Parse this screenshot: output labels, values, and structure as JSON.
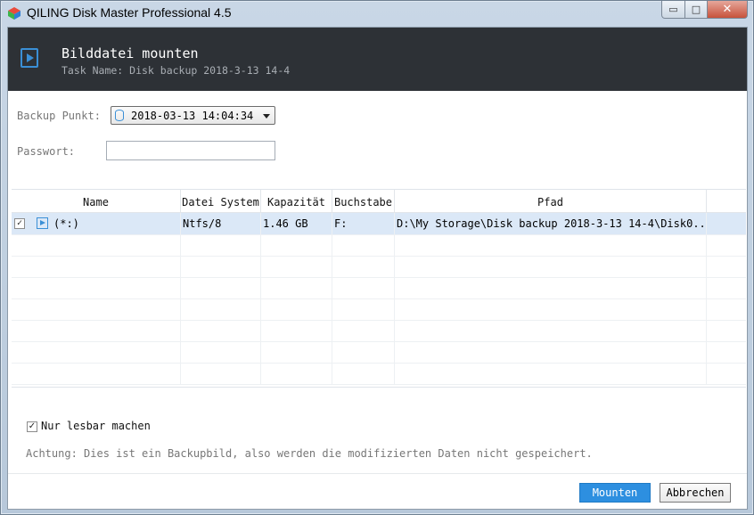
{
  "window": {
    "title": "QILING Disk Master Professional 4.5",
    "controls": {
      "minimize": "▭",
      "maximize": "□",
      "close": "✕"
    }
  },
  "header": {
    "title": "Bilddatei mounten",
    "subtitle": "Task Name: Disk backup 2018-3-13 14-4",
    "icon": "play-icon",
    "background": "#2d3136"
  },
  "form": {
    "backup_point_label": "Backup Punkt:",
    "backup_point_value": "2018-03-13 14:04:34",
    "password_label": "Passwort:",
    "password_value": ""
  },
  "table": {
    "columns": [
      "Name",
      "Datei System",
      "Kapazität",
      "Buchstabe",
      "Pfad"
    ],
    "rows": [
      {
        "checked": true,
        "name": "(*:)",
        "fs": "Ntfs/8",
        "capacity": "1.46 GB",
        "letter": "F:",
        "path": "D:\\My Storage\\Disk backup 2018-3-13 14-4\\Disk0..."
      }
    ],
    "empty_rows": 7
  },
  "options": {
    "readonly_label": "Nur lesbar machen",
    "readonly_checked": true
  },
  "warning": "Achtung: Dies ist ein Backupbild, also werden die modifizierten Daten nicht gespeichert.",
  "buttons": {
    "mount": "Mounten",
    "cancel": "Abbrechen"
  },
  "colors": {
    "accent": "#2d8fe0",
    "selection": "#dbe8f7"
  }
}
